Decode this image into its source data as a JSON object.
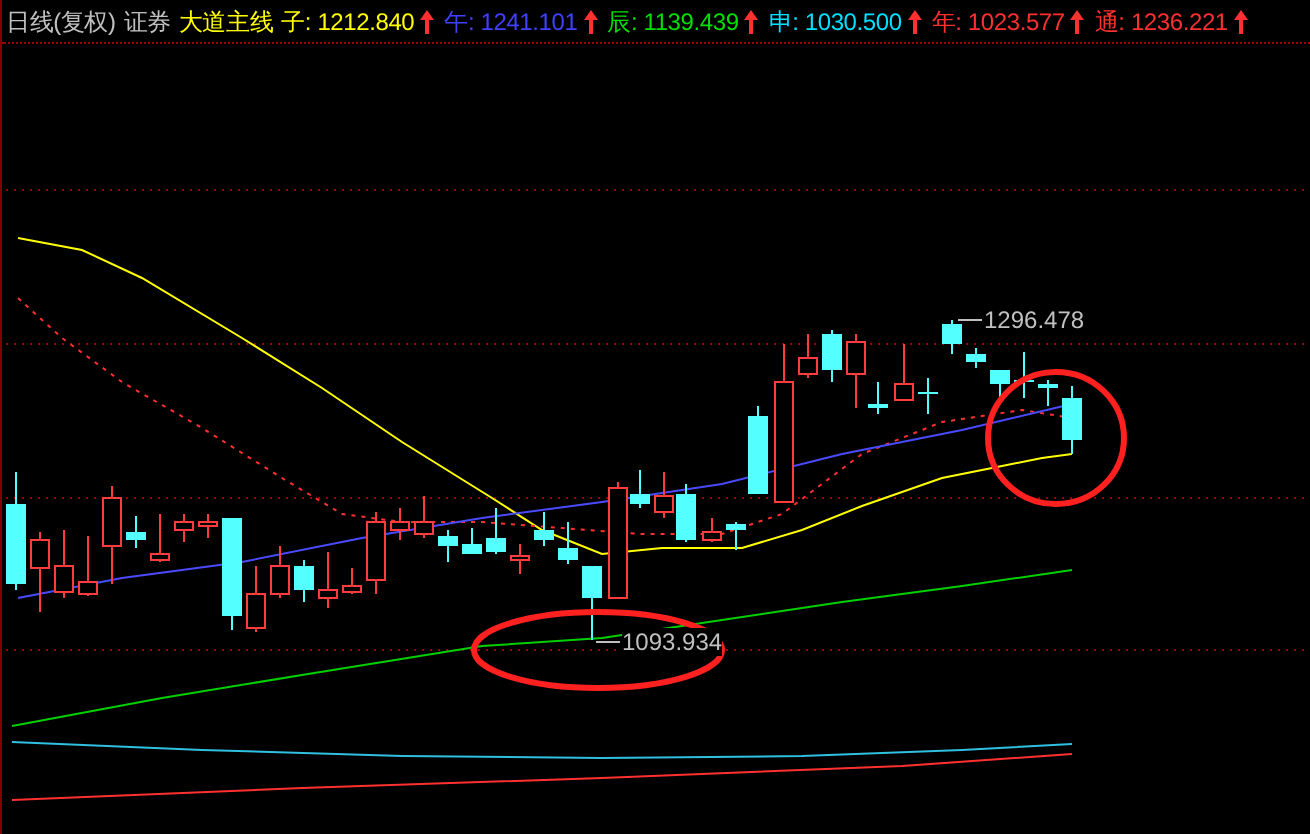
{
  "header": {
    "period": "日线(复权)",
    "stock": "证券",
    "indicator_name": "大道主线",
    "lines": [
      {
        "label": "子:",
        "value": "1212.840",
        "color": "#ffff00"
      },
      {
        "label": "午:",
        "value": "1241.101",
        "color": "#4040ff"
      },
      {
        "label": "辰:",
        "value": "1139.439",
        "color": "#00e000"
      },
      {
        "label": "申:",
        "value": "1030.500",
        "color": "#00e0ff"
      },
      {
        "label": "年:",
        "value": "1023.577",
        "color": "#ff3030"
      },
      {
        "label": "通:",
        "value": "1236.221",
        "color": "#ff3030"
      }
    ]
  },
  "chart": {
    "high_label": "1296.478",
    "low_label": "1093.934"
  }
}
